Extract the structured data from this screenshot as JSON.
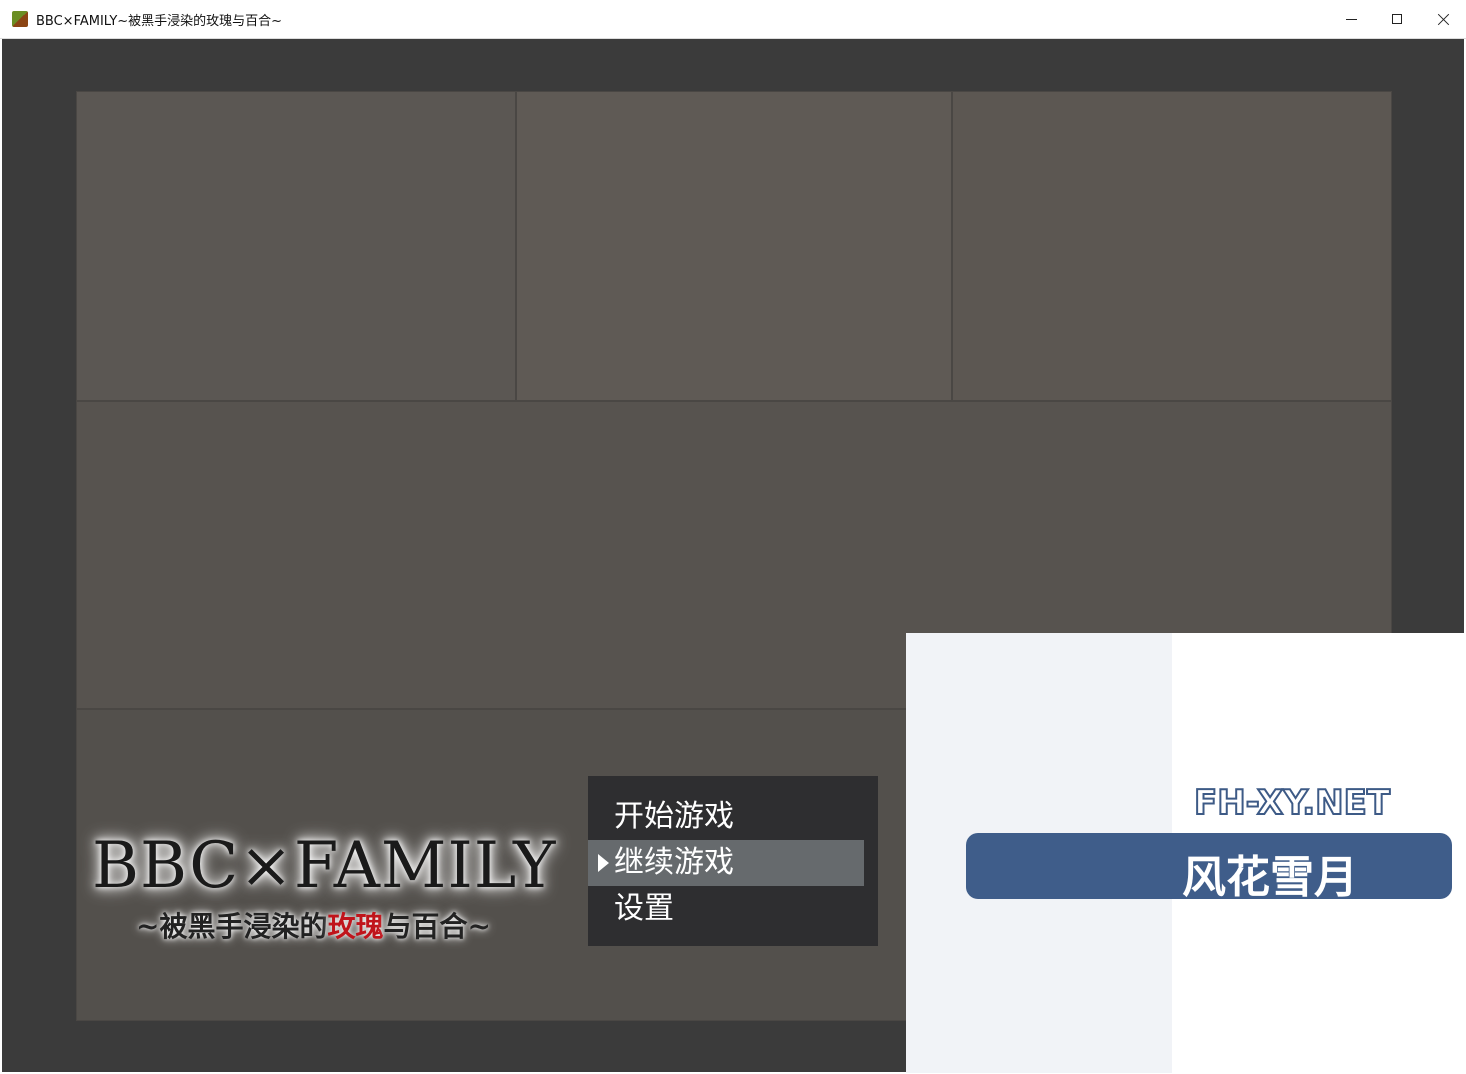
{
  "window": {
    "title": "BBC×FAMILY~被黑手浸染的玫瑰与百合~",
    "controls": {
      "minimize_icon": "minimize-icon",
      "maximize_icon": "maximize-icon",
      "close_icon": "close-icon"
    }
  },
  "logo": {
    "main": "BBC×FAMILY",
    "sub_part1": "~被黑手浸染的",
    "sub_part2": "玫瑰",
    "sub_part3": "与百合~",
    "accent_color": "#c0141b"
  },
  "menu": {
    "items": [
      {
        "label": "开始游戏",
        "selected": false
      },
      {
        "label": "继续游戏",
        "selected": true
      },
      {
        "label": "设置",
        "selected": false
      }
    ]
  },
  "watermark": {
    "url": "FH-XY.NET",
    "name": "风花雪月"
  }
}
